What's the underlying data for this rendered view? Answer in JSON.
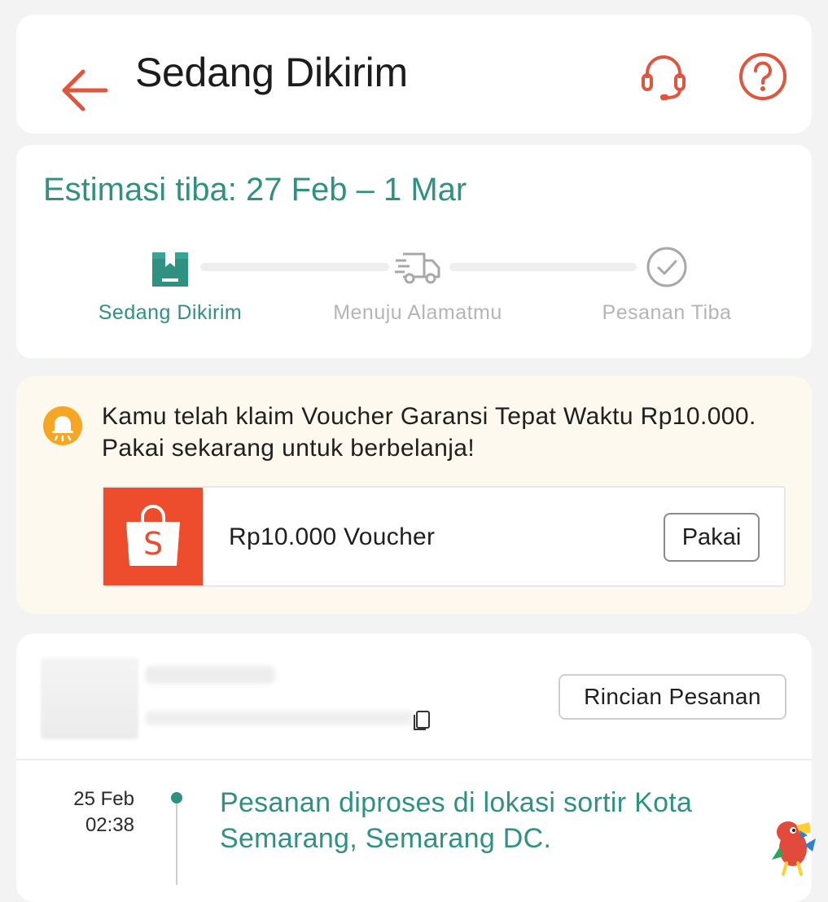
{
  "header": {
    "title": "Sedang Dikirim",
    "back_icon": "arrow-left-icon",
    "support_icon": "headset-icon",
    "help_icon": "question-circle-icon"
  },
  "status": {
    "eta": "Estimasi tiba: 27 Feb – 1 Mar",
    "steps": [
      {
        "label": "Sedang Dikirim",
        "icon": "package-icon",
        "state": "active"
      },
      {
        "label": "Menuju Alamatmu",
        "icon": "truck-icon",
        "state": "pending"
      },
      {
        "label": "Pesanan Tiba",
        "icon": "check-circle-icon",
        "state": "pending"
      }
    ]
  },
  "notice": {
    "message": "Kamu telah klaim Voucher Garansi Tepat Waktu Rp10.000. Pakai sekarang untuk berbelanja!",
    "voucher": {
      "name": "Rp10.000 Voucher",
      "button": "Pakai"
    }
  },
  "order": {
    "detail_button": "Rincian Pesanan",
    "timeline": [
      {
        "date": "25 Feb",
        "time": "02:38",
        "event": "Pesanan diproses di lokasi sortir Kota Semarang, Semarang DC."
      }
    ]
  },
  "colors": {
    "accent_teal": "#2f9182",
    "brand_orange": "#ee4d2d",
    "icon_red": "#e0553b",
    "notice_bg": "#fdf9ee",
    "bell_orange": "#f5a623"
  }
}
